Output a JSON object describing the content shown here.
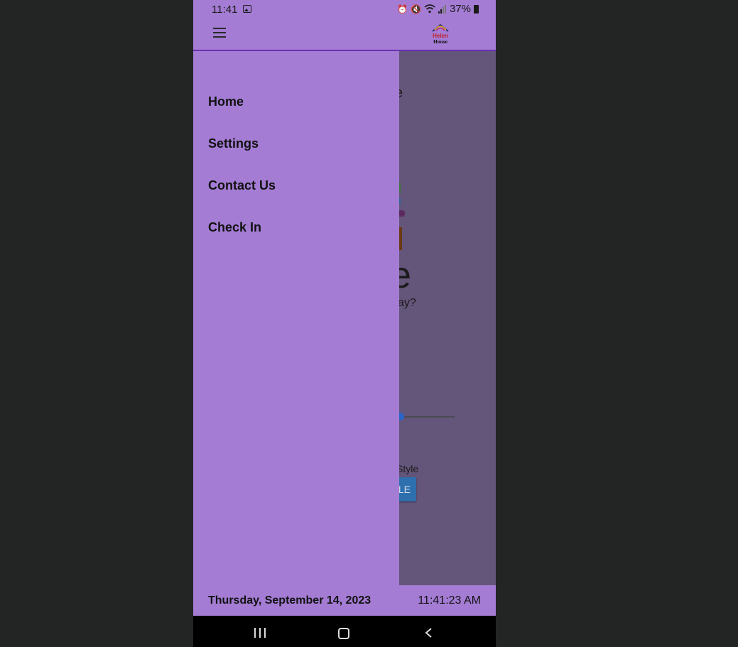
{
  "status_bar": {
    "time": "11:41",
    "battery": "37%",
    "icons": [
      "gallery-icon",
      "alarm-icon",
      "mute-icon",
      "wifi-icon",
      "signal-icon",
      "battery-icon"
    ]
  },
  "app_bar": {
    "menu_icon": "hamburger-icon",
    "logo_text": [
      "Helen",
      "House"
    ]
  },
  "drawer": {
    "items": [
      {
        "label": "Home"
      },
      {
        "label": "Settings"
      },
      {
        "label": "Contact Us"
      },
      {
        "label": "Check In"
      }
    ]
  },
  "background_content": {
    "fragment_e": "e",
    "fragment_big_e": "e",
    "fragment_ay": "ay?",
    "fragment_style": "Style",
    "fragment_button": "LE"
  },
  "footer": {
    "date": "Thursday, September 14, 2023",
    "time": "11:41:23 AM"
  },
  "nav_bar": {
    "icons": [
      "recent-apps-icon",
      "home-icon",
      "back-icon"
    ]
  },
  "colors": {
    "app_purple": "#a47cd4",
    "scrim": "#64557a",
    "accent_line": "#6a2fb0",
    "background": "#222524"
  }
}
